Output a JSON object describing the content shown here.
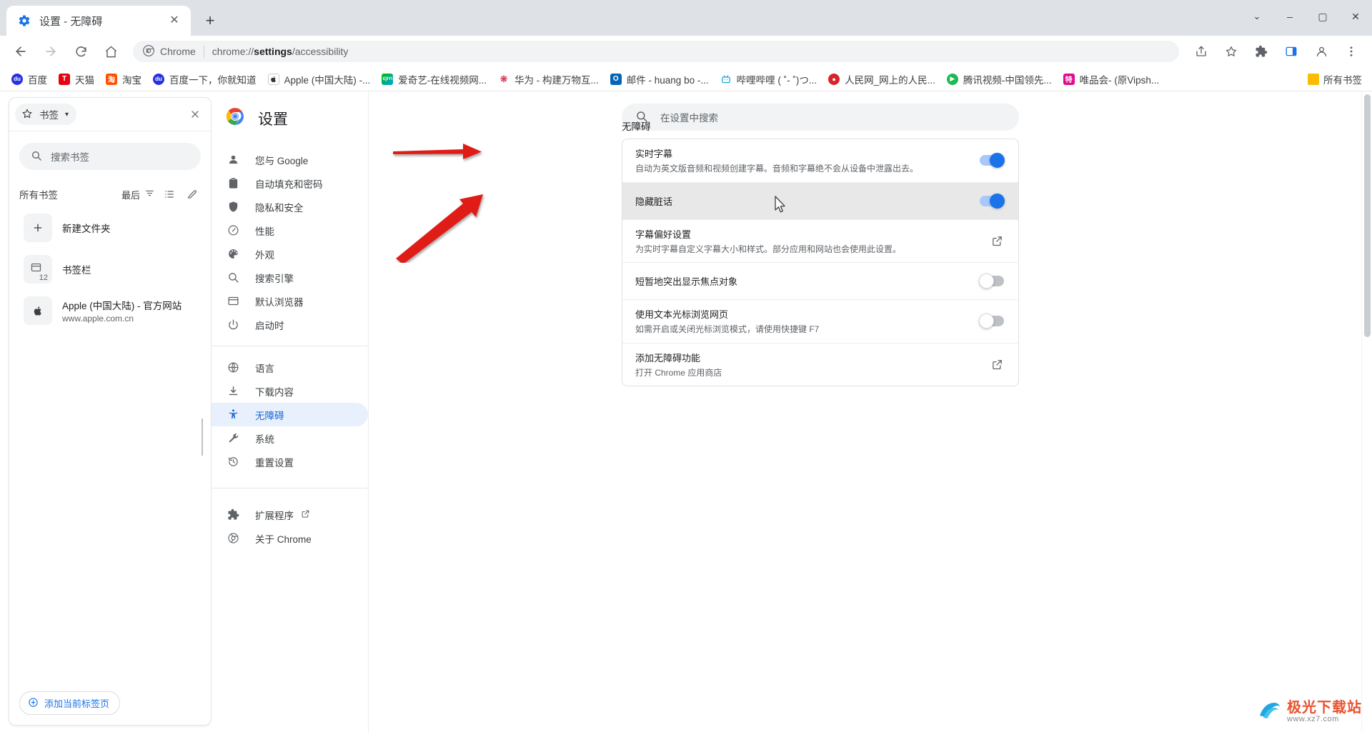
{
  "window": {
    "tab_title": "设置 - 无障碍",
    "tab_favicon": "settings-gear-icon",
    "new_tab_label": "+",
    "close_tab_label": "✕",
    "controls": {
      "more": "⌄",
      "minimize": "–",
      "maximize": "▢",
      "close": "✕"
    }
  },
  "toolbar": {
    "back": "←",
    "forward": "→",
    "reload": "⟳",
    "home": "⌂",
    "omnibox_chip": "Chrome",
    "omnibox_url_prefix": "chrome://",
    "omnibox_url_bold": "settings",
    "omnibox_url_suffix": "/accessibility",
    "share": "share-icon",
    "bookmark_star": "star-icon",
    "extensions": "puzzle-icon",
    "sidepanel": "side-panel-icon",
    "profile": "profile-icon",
    "menu": "three-dot-menu-icon"
  },
  "bookmarks_bar": {
    "items": [
      {
        "label": "百度",
        "icon": "baidu",
        "color": "#2932e1"
      },
      {
        "label": "天猫",
        "icon": "tmall",
        "color": "#e60012"
      },
      {
        "label": "淘宝",
        "icon": "taobao",
        "color": "#ff5000"
      },
      {
        "label": "百度一下，你就知道",
        "icon": "baidu",
        "color": "#2932e1"
      },
      {
        "label": "Apple (中国大陆) -...",
        "icon": "apple",
        "color": "#555555"
      },
      {
        "label": "爱奇艺-在线视频网...",
        "icon": "iqiyi",
        "color": "#00be06"
      },
      {
        "label": "华为 - 构建万物互...",
        "icon": "huawei",
        "color": "#cf0a2c"
      },
      {
        "label": "邮件 - huang bo -...",
        "icon": "outlook",
        "color": "#0364b8"
      },
      {
        "label": "哔哩哔哩 ( ˚- ˚)つ...",
        "icon": "bilibili",
        "color": "#00a1d6"
      },
      {
        "label": "人民网_网上的人民...",
        "icon": "people",
        "color": "#d8232a"
      },
      {
        "label": "腾讯视频-中国领先...",
        "icon": "tencent",
        "color": "#1db954"
      },
      {
        "label": "唯品会- (原Vipsh...",
        "icon": "vip",
        "color": "#e10a8c"
      }
    ],
    "all_bookmarks_label": "所有书签",
    "all_bookmarks_icon": "folder-icon"
  },
  "side_panel": {
    "combo_label": "书签",
    "combo_icon": "star-icon",
    "combo_caret": "▾",
    "close_icon": "close-icon",
    "search_placeholder": "搜索书签",
    "search_icon": "search-icon",
    "header_label": "所有书签",
    "sort_label": "最后",
    "sort_icon": "filter-icon",
    "list_view_icon": "list-icon",
    "edit_icon": "pencil-icon",
    "items": [
      {
        "title": "新建文件夹",
        "sub": "",
        "thumb": "plus-icon",
        "count": ""
      },
      {
        "title": "书签栏",
        "sub": "",
        "thumb": "folder-icon",
        "count": "12"
      },
      {
        "title": "Apple (中国大陆) - 官方网站",
        "sub": "www.apple.com.cn",
        "thumb": "apple-icon",
        "count": ""
      }
    ],
    "add_current_tab_label": "添加当前标签页",
    "add_current_tab_icon": "plus-circle-icon"
  },
  "settings": {
    "brand_title": "设置",
    "brand_icon": "chrome-logo",
    "search_placeholder": "在设置中搜索",
    "search_icon": "search-icon",
    "nav_groups": [
      {
        "items": [
          {
            "label": "您与 Google",
            "icon": "person-icon",
            "active": false
          },
          {
            "label": "自动填充和密码",
            "icon": "clipboard-icon",
            "active": false
          },
          {
            "label": "隐私和安全",
            "icon": "shield-icon",
            "active": false
          },
          {
            "label": "性能",
            "icon": "speedometer-icon",
            "active": false
          },
          {
            "label": "外观",
            "icon": "palette-icon",
            "active": false
          },
          {
            "label": "搜索引擎",
            "icon": "search-icon",
            "active": false
          },
          {
            "label": "默认浏览器",
            "icon": "browser-icon",
            "active": false
          },
          {
            "label": "启动时",
            "icon": "power-icon",
            "active": false
          }
        ]
      },
      {
        "items": [
          {
            "label": "语言",
            "icon": "globe-icon",
            "active": false
          },
          {
            "label": "下载内容",
            "icon": "download-icon",
            "active": false
          },
          {
            "label": "无障碍",
            "icon": "accessibility-icon",
            "active": true
          },
          {
            "label": "系统",
            "icon": "wrench-icon",
            "active": false
          },
          {
            "label": "重置设置",
            "icon": "restore-icon",
            "active": false
          }
        ]
      },
      {
        "items": [
          {
            "label": "扩展程序",
            "icon": "extension-icon",
            "active": false,
            "external": true
          },
          {
            "label": "关于 Chrome",
            "icon": "chrome-outline-icon",
            "active": false
          }
        ]
      }
    ],
    "section_title": "无障碍",
    "rows": [
      {
        "title": "实时字幕",
        "sub": "自动为英文版音频和视频创建字幕。音频和字幕绝不会从设备中泄露出去。",
        "control": "toggle",
        "state": "on",
        "highlighted": false
      },
      {
        "title": "隐藏脏话",
        "sub": "",
        "control": "toggle",
        "state": "on",
        "highlighted": true
      },
      {
        "title": "字幕偏好设置",
        "sub": "为实时字幕自定义字幕大小和样式。部分应用和网站也会使用此设置。",
        "control": "external-link",
        "state": "",
        "highlighted": false
      },
      {
        "title": "短暂地突出显示焦点对象",
        "sub": "",
        "control": "toggle",
        "state": "off",
        "highlighted": false
      },
      {
        "title": "使用文本光标浏览网页",
        "sub": "如需开启或关闭光标浏览模式，请使用快捷键 F7",
        "control": "toggle",
        "state": "off",
        "highlighted": false
      },
      {
        "title": "添加无障碍功能",
        "sub": "打开 Chrome 应用商店",
        "control": "external-link",
        "state": "",
        "highlighted": false
      }
    ]
  },
  "annotations": {
    "arrow_color": "#e01b14",
    "arrows": [
      {
        "name": "arrow-to-live-caption"
      },
      {
        "name": "arrow-to-hide-profanity"
      }
    ],
    "cursor": "mouse-pointer"
  },
  "watermark": {
    "main": "极光下载站",
    "sub": "www.xz7.com",
    "icon": "aurora-logo"
  },
  "colors": {
    "accent": "#1a73e8",
    "active_nav_bg": "#e8f0fe",
    "tabstrip_bg": "#dee1e6",
    "row_highlight": "#e8e8e8",
    "arrow_red": "#e01b14"
  }
}
